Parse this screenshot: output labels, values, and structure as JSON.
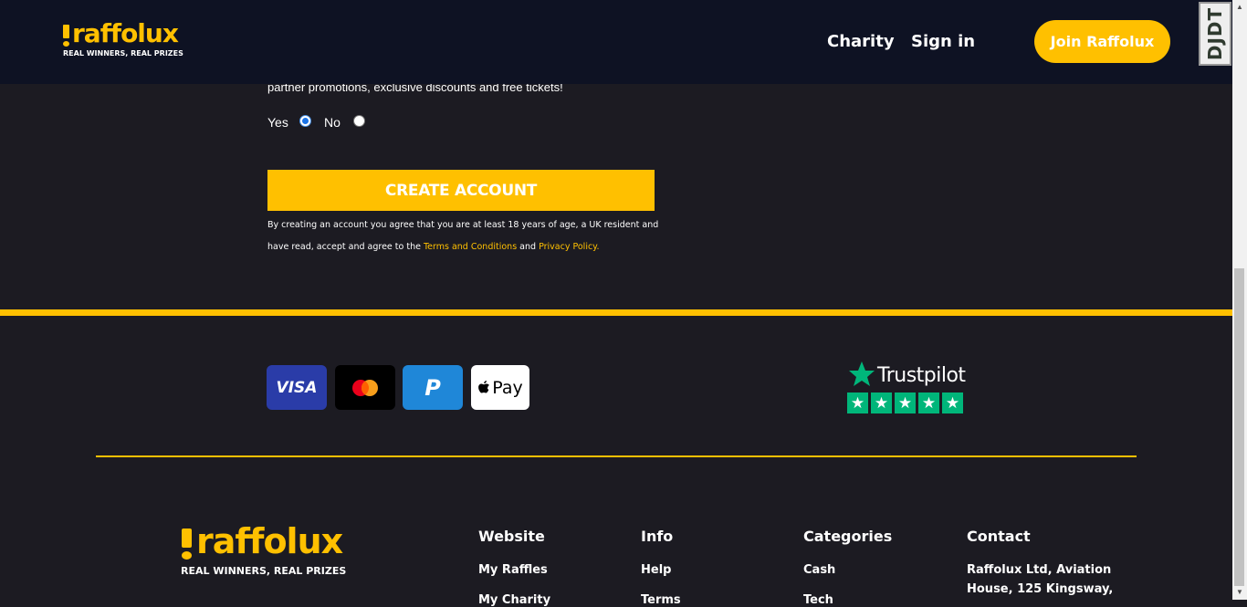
{
  "header": {
    "logo_name": "raffolux",
    "logo_tagline": "REAL WINNERS, REAL PRIZES",
    "nav": {
      "charity": "Charity",
      "sign_in": "Sign in"
    },
    "join_label": "Join Raffolux",
    "devtools_label": "DJDT"
  },
  "form": {
    "promo_text": "partner promotions, exclusive discounts and free tickets!",
    "yes_label": "Yes",
    "no_label": "No",
    "selected": "Yes",
    "create_label": "CREATE ACCOUNT",
    "terms_prefix": "By creating an account you agree that you are at least 18 years of age, a UK resident and have read, accept and agree to the ",
    "terms_link": "Terms and Conditions",
    "terms_and": " and ",
    "privacy_link": "Privacy Policy."
  },
  "payments": {
    "visa": "VISA",
    "paypal": "P",
    "applepay": "Pay"
  },
  "trustpilot": {
    "name": "Trustpilot",
    "stars": 5
  },
  "footer": {
    "logo_name": "raffolux",
    "logo_tagline": "REAL WINNERS, REAL PRIZES",
    "columns": [
      {
        "heading": "Website",
        "links": [
          "My Raffles",
          "My Charity"
        ]
      },
      {
        "heading": "Info",
        "links": [
          "Help",
          "Terms"
        ]
      },
      {
        "heading": "Categories",
        "links": [
          "Cash",
          "Tech"
        ]
      },
      {
        "heading": "Contact",
        "lines": [
          "Raffolux Ltd, Aviation",
          "House, 125 Kingsway,"
        ]
      }
    ]
  },
  "colors": {
    "accent": "#ffc000",
    "header_bg": "#0e1223",
    "page_bg": "#1c1b22",
    "trustpilot_green": "#00b67a"
  }
}
